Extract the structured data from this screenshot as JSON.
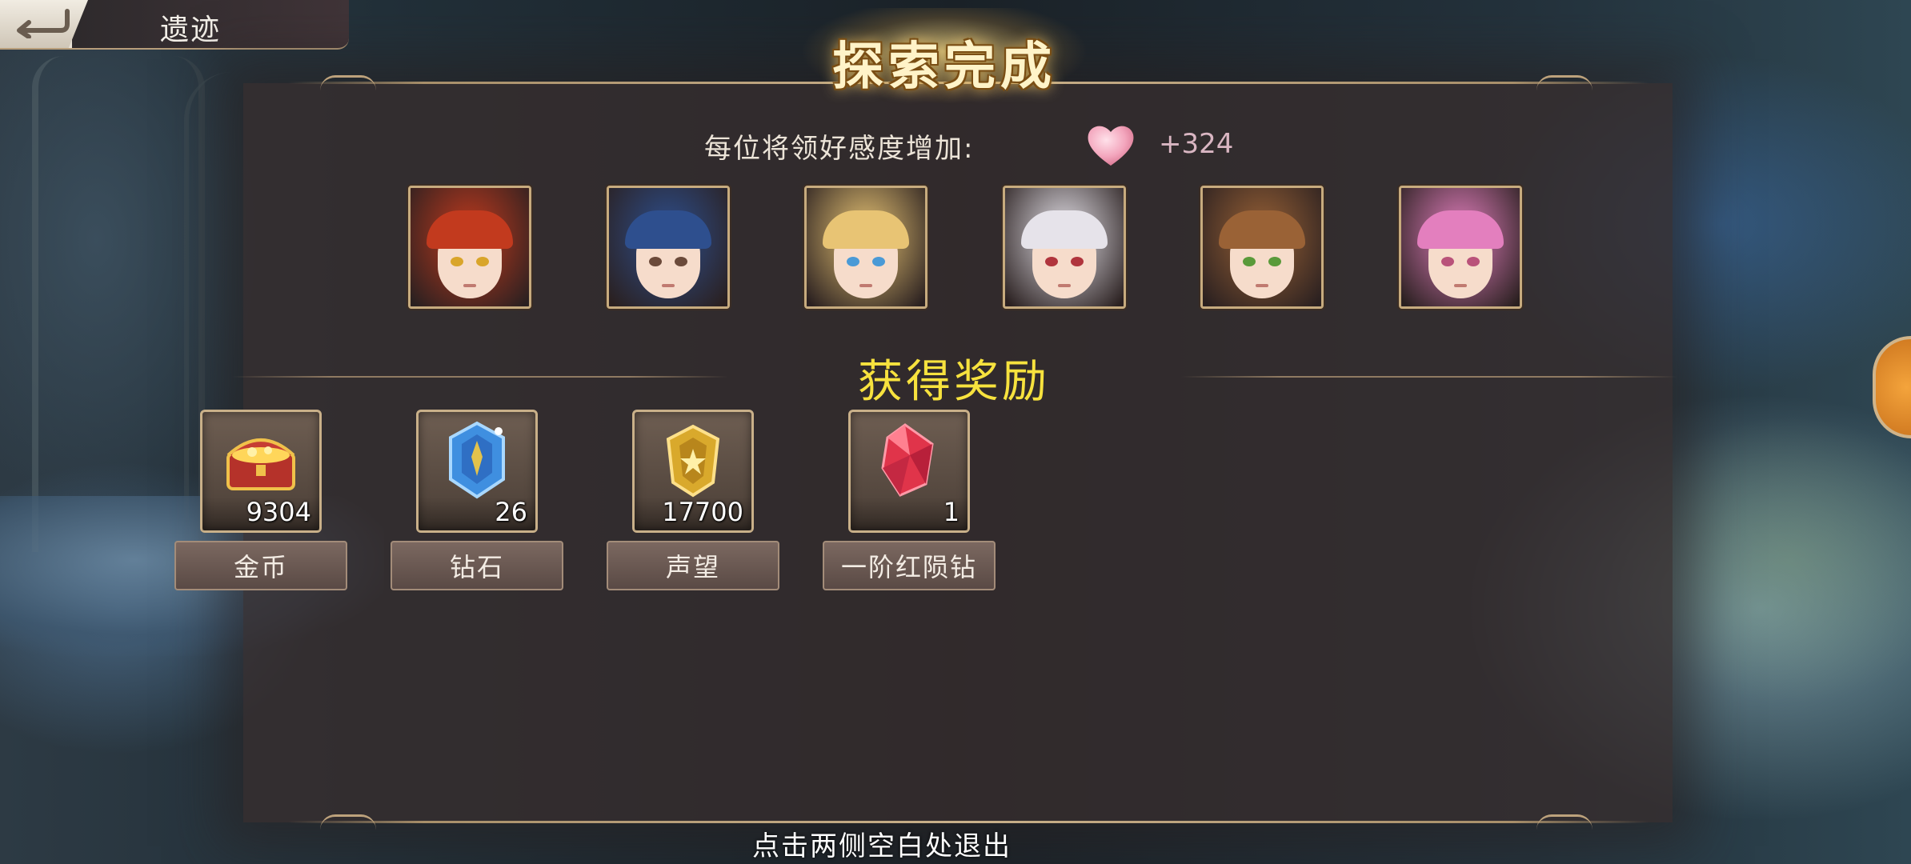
{
  "header": {
    "back_icon": "back-arrow-icon",
    "title": "遗迹"
  },
  "panel": {
    "title": "探索完成",
    "favor_label": "每位将领好感度增加:",
    "favor_icon": "heart-icon",
    "favor_value": "+324",
    "rewards_title": "获得奖励",
    "exit_hint": "点击两侧空白处退出"
  },
  "portraits": [
    {
      "name": "portrait-red-hair-boy",
      "hair": "#c23a1e",
      "eye": "#d9a52a"
    },
    {
      "name": "portrait-blue-hair-girl",
      "hair": "#2e4f8e",
      "eye": "#6b4a3a"
    },
    {
      "name": "portrait-blonde-girl",
      "hair": "#e8c474",
      "eye": "#4a9ad6"
    },
    {
      "name": "portrait-white-hair-girl",
      "hair": "#e6e3ea",
      "eye": "#b0353d"
    },
    {
      "name": "portrait-brown-hair-masked-girl",
      "hair": "#9a6236",
      "eye": "#5a9a3a"
    },
    {
      "name": "portrait-pink-hair-girl",
      "hair": "#e37fbe",
      "eye": "#b9527a"
    }
  ],
  "rewards": [
    {
      "label": "金币",
      "count": "9304",
      "icon": "treasure-chest-icon"
    },
    {
      "label": "钻石",
      "count": "26",
      "icon": "blue-crystal-icon"
    },
    {
      "label": "声望",
      "count": "17700",
      "icon": "gold-emblem-icon"
    },
    {
      "label": "一阶红陨钻",
      "count": "1",
      "icon": "red-gem-icon"
    }
  ],
  "colors": {
    "title_gold": "#fff3c8",
    "rewards_title_yellow": "#f7e23e",
    "favor_value_pink": "#d9b6c2"
  }
}
